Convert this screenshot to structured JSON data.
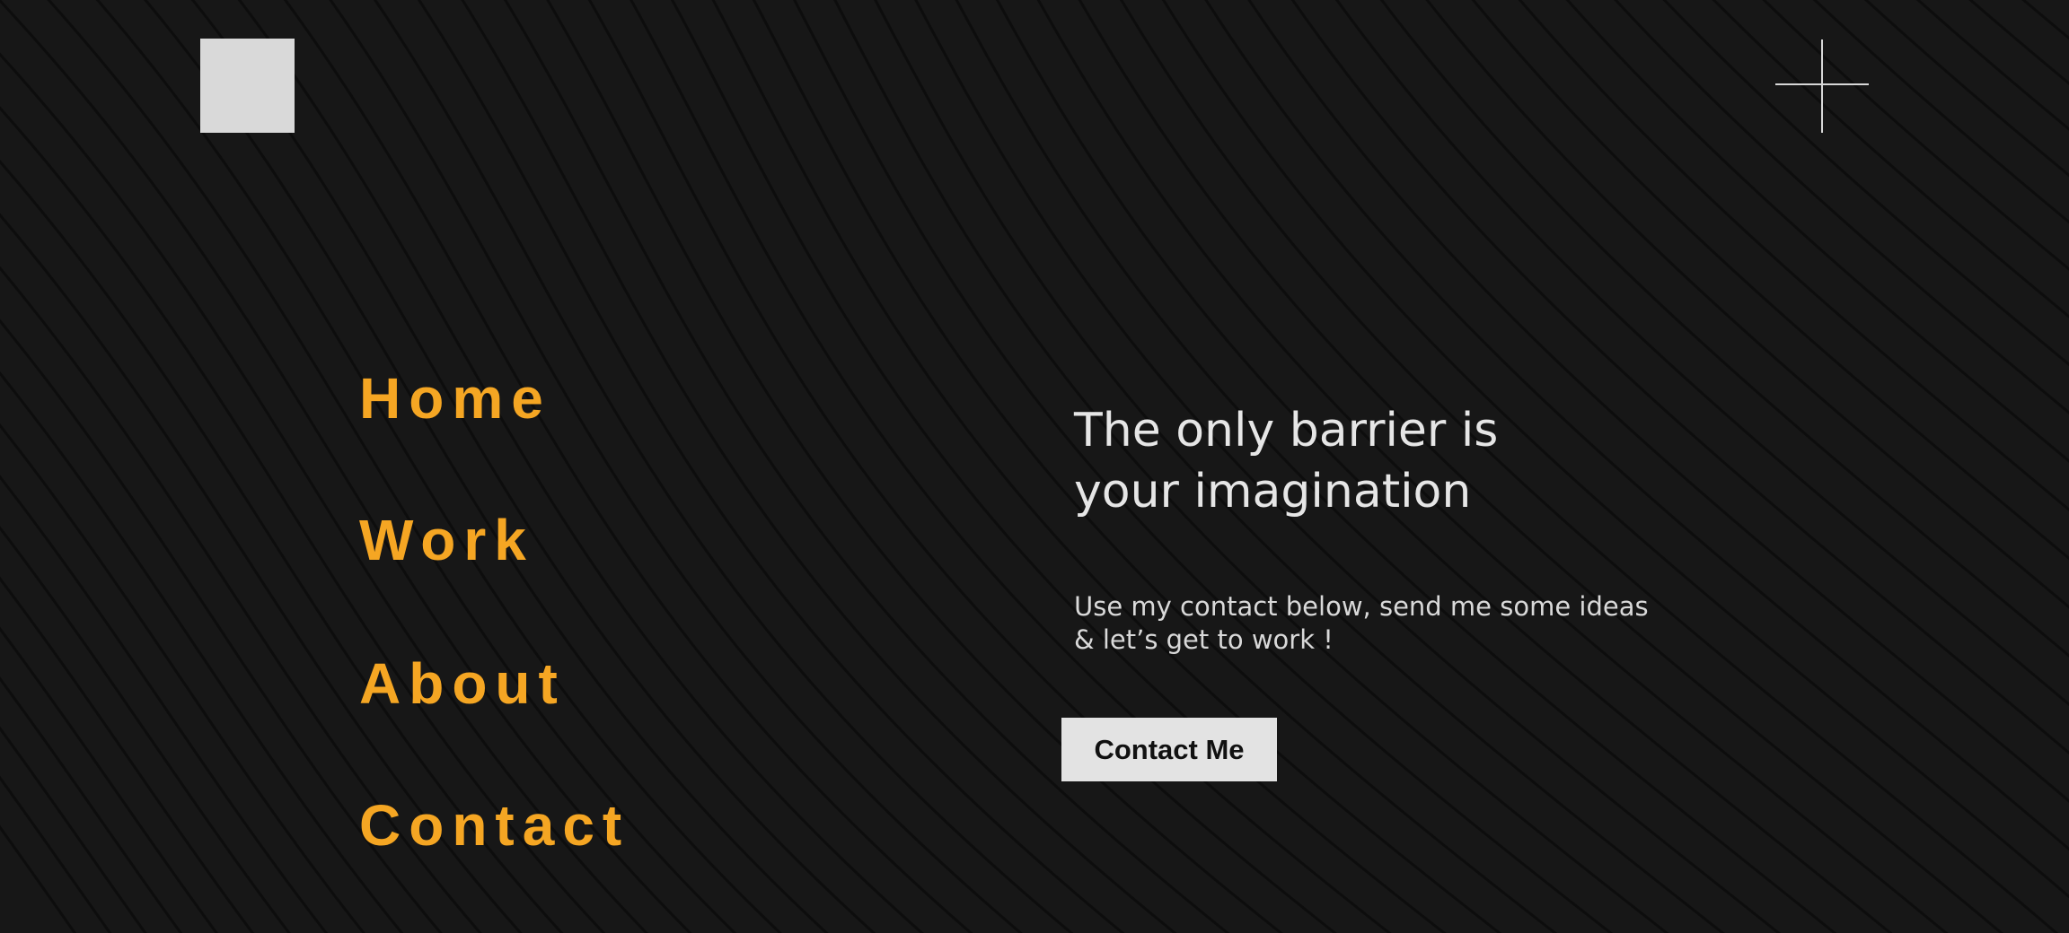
{
  "header": {
    "logo_icon": "square-logo-icon",
    "close_icon": "close-cross-icon"
  },
  "nav": {
    "items": [
      {
        "label": "Home"
      },
      {
        "label": "Work"
      },
      {
        "label": "About"
      },
      {
        "label": "Contact"
      }
    ]
  },
  "hero": {
    "title_line1": "The only barrier is",
    "title_line2": "your imagination",
    "text_line1": "Use my contact below, send me some ideas",
    "text_line2": "& let’s get to work !",
    "button_label": "Contact Me"
  },
  "colors": {
    "background": "#171717",
    "accent": "#f5a623",
    "text": "#e6e6e6",
    "button_bg": "#e3e3e3",
    "wave_lines": "#0b0b0b"
  }
}
